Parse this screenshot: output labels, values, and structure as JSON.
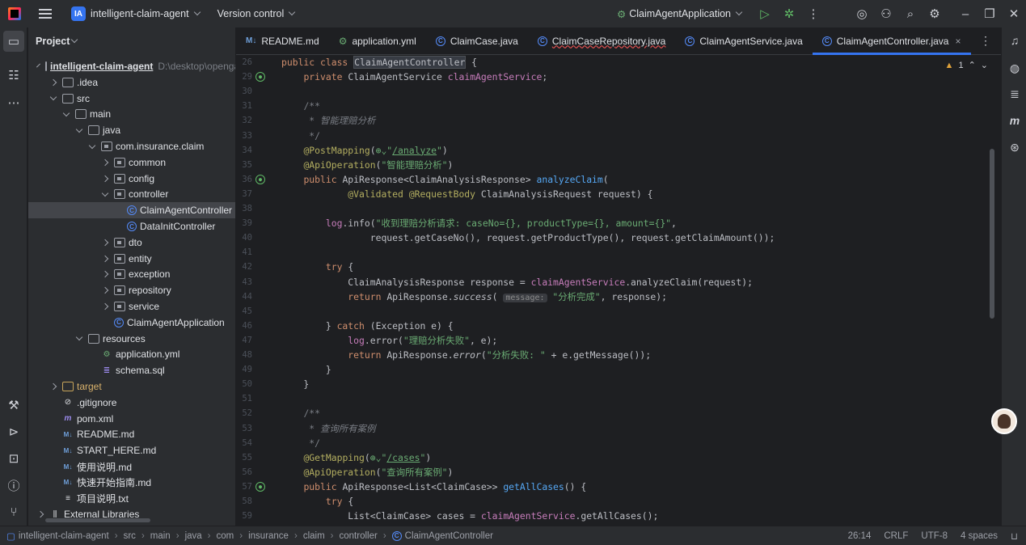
{
  "titlebar": {
    "project_badge": "IA",
    "project_name": "intelligent-claim-agent",
    "vcs": "Version control",
    "run_config": "ClaimAgentApplication"
  },
  "project_panel": {
    "title": "Project",
    "root_path": "D:\\desktop\\openga",
    "items": [
      {
        "label": "intelligent-claim-agent",
        "indent": 0,
        "arrow": "open",
        "icon": "folder",
        "bold": true
      },
      {
        "label": ".idea",
        "indent": 1,
        "arrow": "closed",
        "icon": "folder"
      },
      {
        "label": "src",
        "indent": 1,
        "arrow": "open",
        "icon": "folder"
      },
      {
        "label": "main",
        "indent": 2,
        "arrow": "open",
        "icon": "folder"
      },
      {
        "label": "java",
        "indent": 3,
        "arrow": "open",
        "icon": "folder"
      },
      {
        "label": "com.insurance.claim",
        "indent": 4,
        "arrow": "open",
        "icon": "pkg"
      },
      {
        "label": "common",
        "indent": 5,
        "arrow": "closed",
        "icon": "pkg"
      },
      {
        "label": "config",
        "indent": 5,
        "arrow": "closed",
        "icon": "pkg"
      },
      {
        "label": "controller",
        "indent": 5,
        "arrow": "open",
        "icon": "pkg"
      },
      {
        "label": "ClaimAgentController",
        "indent": 6,
        "arrow": "none",
        "icon": "class",
        "selected": true
      },
      {
        "label": "DataInitController",
        "indent": 6,
        "arrow": "none",
        "icon": "class"
      },
      {
        "label": "dto",
        "indent": 5,
        "arrow": "closed",
        "icon": "pkg"
      },
      {
        "label": "entity",
        "indent": 5,
        "arrow": "closed",
        "icon": "pkg"
      },
      {
        "label": "exception",
        "indent": 5,
        "arrow": "closed",
        "icon": "pkg"
      },
      {
        "label": "repository",
        "indent": 5,
        "arrow": "closed",
        "icon": "pkg"
      },
      {
        "label": "service",
        "indent": 5,
        "arrow": "closed",
        "icon": "pkg"
      },
      {
        "label": "ClaimAgentApplication",
        "indent": 5,
        "arrow": "none",
        "icon": "app"
      },
      {
        "label": "resources",
        "indent": 3,
        "arrow": "open",
        "icon": "folder"
      },
      {
        "label": "application.yml",
        "indent": 4,
        "arrow": "none",
        "icon": "yml"
      },
      {
        "label": "schema.sql",
        "indent": 4,
        "arrow": "none",
        "icon": "sql"
      },
      {
        "label": "target",
        "indent": 1,
        "arrow": "closed",
        "icon": "folder-orange"
      },
      {
        "label": ".gitignore",
        "indent": 1,
        "arrow": "none",
        "icon": "ignore"
      },
      {
        "label": "pom.xml",
        "indent": 1,
        "arrow": "none",
        "icon": "maven"
      },
      {
        "label": "README.md",
        "indent": 1,
        "arrow": "none",
        "icon": "md"
      },
      {
        "label": "START_HERE.md",
        "indent": 1,
        "arrow": "none",
        "icon": "md"
      },
      {
        "label": "使用说明.md",
        "indent": 1,
        "arrow": "none",
        "icon": "md"
      },
      {
        "label": "快速开始指南.md",
        "indent": 1,
        "arrow": "none",
        "icon": "md"
      },
      {
        "label": "项目说明.txt",
        "indent": 1,
        "arrow": "none",
        "icon": "txt"
      },
      {
        "label": "External Libraries",
        "indent": 0,
        "arrow": "closed",
        "icon": "lib"
      }
    ]
  },
  "tabs": [
    {
      "label": "README.md",
      "icon": "md"
    },
    {
      "label": "application.yml",
      "icon": "yml"
    },
    {
      "label": "ClaimCase.java",
      "icon": "class"
    },
    {
      "label": "ClaimCaseRepository.java",
      "icon": "class",
      "error": true
    },
    {
      "label": "ClaimAgentService.java",
      "icon": "class"
    },
    {
      "label": "ClaimAgentController.java",
      "icon": "class",
      "active": true
    }
  ],
  "inspections": {
    "warnings": "1"
  },
  "code": [
    {
      "n": "26",
      "html": "<span class=\"kw\">public class </span><span class=\"hl\">ClaimAgentController</span> {"
    },
    {
      "n": "29",
      "gut": true,
      "html": "    <span class=\"kw\">private </span>ClaimAgentService <span class=\"fld\">claimAgentService</span>;"
    },
    {
      "n": "30",
      "html": ""
    },
    {
      "n": "31",
      "html": "    <span class=\"cm\">/**</span>"
    },
    {
      "n": "32",
      "html": "<span class=\"cm ita\">     * 智能理赔分析</span>"
    },
    {
      "n": "33",
      "html": "<span class=\"cm\">     */</span>"
    },
    {
      "n": "34",
      "html": "    <span class=\"an\">@PostMapping</span>(<span class=\"str\">⊕⌄\"<span class=\"ul\">/analyze</span>\"</span>)"
    },
    {
      "n": "35",
      "html": "    <span class=\"an\">@ApiOperation</span>(<span class=\"str\">\"智能理赔分析\"</span>)"
    },
    {
      "n": "36",
      "gut": true,
      "html": "    <span class=\"kw\">public </span>ApiResponse&lt;ClaimAnalysisResponse&gt; <span class=\"fn\">analyzeClaim</span>("
    },
    {
      "n": "37",
      "html": "            <span class=\"an\">@Validated @RequestBody </span>ClaimAnalysisRequest request) {"
    },
    {
      "n": "38",
      "html": ""
    },
    {
      "n": "39",
      "html": "        <span class=\"fld\">log</span>.info(<span class=\"str\">\"收到理赔分析请求: caseNo={}, productType={}, amount={}\"</span>,"
    },
    {
      "n": "40",
      "html": "                request.getCaseNo(), request.getProductType(), request.getClaimAmount());"
    },
    {
      "n": "41",
      "html": ""
    },
    {
      "n": "42",
      "html": "        <span class=\"kw\">try </span>{"
    },
    {
      "n": "43",
      "html": "            ClaimAnalysisResponse response = <span class=\"fld\">claimAgentService</span>.analyzeClaim(request);"
    },
    {
      "n": "44",
      "html": "            <span class=\"kw\">return </span>ApiResponse.<span class=\"ita\">success</span>( <span class=\"hint\">message:</span> <span class=\"str\">\"分析完成\"</span>, response);"
    },
    {
      "n": "45",
      "html": ""
    },
    {
      "n": "46",
      "html": "        } <span class=\"kw\">catch </span>(Exception e) {"
    },
    {
      "n": "47",
      "html": "            <span class=\"fld\">log</span>.error(<span class=\"str\">\"理赔分析失败\"</span>, e);"
    },
    {
      "n": "48",
      "html": "            <span class=\"kw\">return </span>ApiResponse.<span class=\"ita\">error</span>(<span class=\"str\">\"分析失败: \"</span> + e.getMessage());"
    },
    {
      "n": "49",
      "html": "        }"
    },
    {
      "n": "50",
      "html": "    }"
    },
    {
      "n": "51",
      "html": ""
    },
    {
      "n": "52",
      "html": "    <span class=\"cm\">/**</span>"
    },
    {
      "n": "53",
      "html": "<span class=\"cm ita\">     * 查询所有案例</span>"
    },
    {
      "n": "54",
      "html": "<span class=\"cm\">     */</span>"
    },
    {
      "n": "55",
      "html": "    <span class=\"an\">@GetMapping</span>(<span class=\"str\">⊕⌄\"<span class=\"ul\">/cases</span>\"</span>)"
    },
    {
      "n": "56",
      "html": "    <span class=\"an\">@ApiOperation</span>(<span class=\"str\">\"查询所有案例\"</span>)"
    },
    {
      "n": "57",
      "gut": true,
      "html": "    <span class=\"kw\">public </span>ApiResponse&lt;List&lt;ClaimCase&gt;&gt; <span class=\"fn\">getAllCases</span>() {"
    },
    {
      "n": "58",
      "html": "        <span class=\"kw\">try </span>{"
    },
    {
      "n": "59",
      "html": "            List&lt;ClaimCase&gt; cases = <span class=\"fld\">claimAgentService</span>.getAllCases();"
    }
  ],
  "breadcrumb": [
    "intelligent-claim-agent",
    "src",
    "main",
    "java",
    "com",
    "insurance",
    "claim",
    "controller",
    "ClaimAgentController"
  ],
  "status": {
    "position": "26:14",
    "line_sep": "CRLF",
    "encoding": "UTF-8",
    "indent": "4 spaces"
  }
}
